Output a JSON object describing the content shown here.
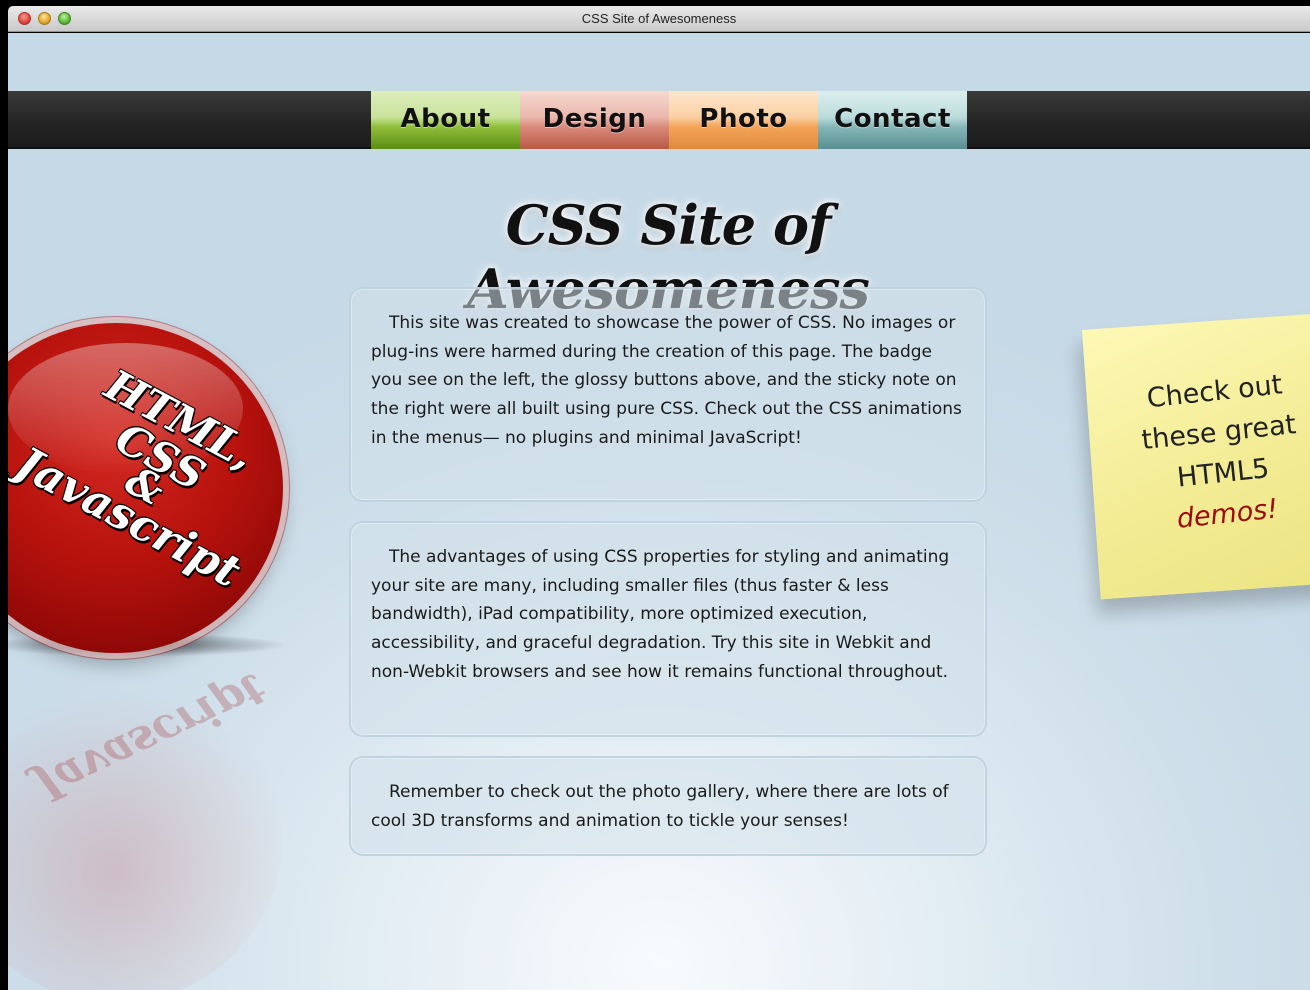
{
  "window": {
    "title": "CSS Site of Awesomeness"
  },
  "nav": {
    "items": [
      {
        "label": "About",
        "color": "#6a9b1b"
      },
      {
        "label": "Design",
        "color": "#c9634f"
      },
      {
        "label": "Photo",
        "color": "#f09a47"
      },
      {
        "label": "Contact",
        "color": "#6a9ea0"
      }
    ]
  },
  "main": {
    "headline": "CSS Site of Awesomeness",
    "paragraphs": [
      "This site was created to showcase the power of CSS. No images or plug-ins were harmed during the creation of this page. The badge you see on the left, the glossy buttons above, and the sticky note on the right were all built using pure CSS. Check out the CSS animations in the menus— no plugins and minimal JavaScript!",
      "The advantages of using CSS properties for styling and animating your site are many, including smaller files (thus faster & less bandwidth), iPad compatibility, more optimized execution, accessibility, and graceful degradation. Try this site in Webkit and non-Webkit browsers and see how it remains functional throughout.",
      "Remember to check out the photo gallery, where there are lots of cool 3D transforms and animation to tickle your senses!"
    ]
  },
  "badge": {
    "line1": "HTML, CSS",
    "line2": "&",
    "line3": "Javascript",
    "color": "#b8120d"
  },
  "sticky_note": {
    "line1": "Check out",
    "line2": "these great",
    "line3": "HTML5",
    "line4": "demos!",
    "accent_color": "#9d0c0c"
  }
}
